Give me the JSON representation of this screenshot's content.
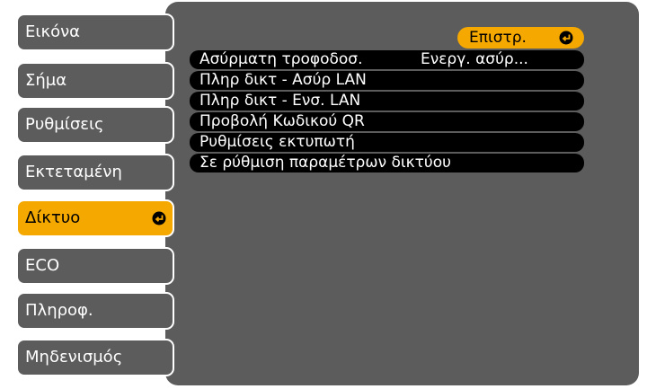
{
  "sidebar": {
    "items": [
      {
        "label": "Εικόνα"
      },
      {
        "label": "Σήμα"
      },
      {
        "label": "Ρυθμίσεις"
      },
      {
        "label": "Εκτεταμένη"
      },
      {
        "label": "Δίκτυο"
      },
      {
        "label": "ECO"
      },
      {
        "label": "Πληροφ."
      },
      {
        "label": "Μηδενισμός"
      }
    ],
    "active_item": "Δίκτυο"
  },
  "main": {
    "back_button_label": "Επιστρ.",
    "rows": [
      {
        "label": "Ασύρματη τροφοδοσ.",
        "value": "Ενεργ. ασύρ..."
      },
      {
        "label": "Πληρ δικτ - Ασύρ LAN"
      },
      {
        "label": "Πληρ δικτ - Ενσ. LAN"
      },
      {
        "label": "Προβολή Κωδικού QR"
      },
      {
        "label": "Ρυθμίσεις εκτυπωτή"
      },
      {
        "label": "Σε ρύθμιση παραμέτρων δικτύου"
      }
    ]
  },
  "colors": {
    "panel_gray": "#5c5c5c",
    "highlight_orange": "#f5a800",
    "row_black": "#000000",
    "text_white": "#ffffff"
  },
  "icons": {
    "enter": "enter-icon"
  }
}
